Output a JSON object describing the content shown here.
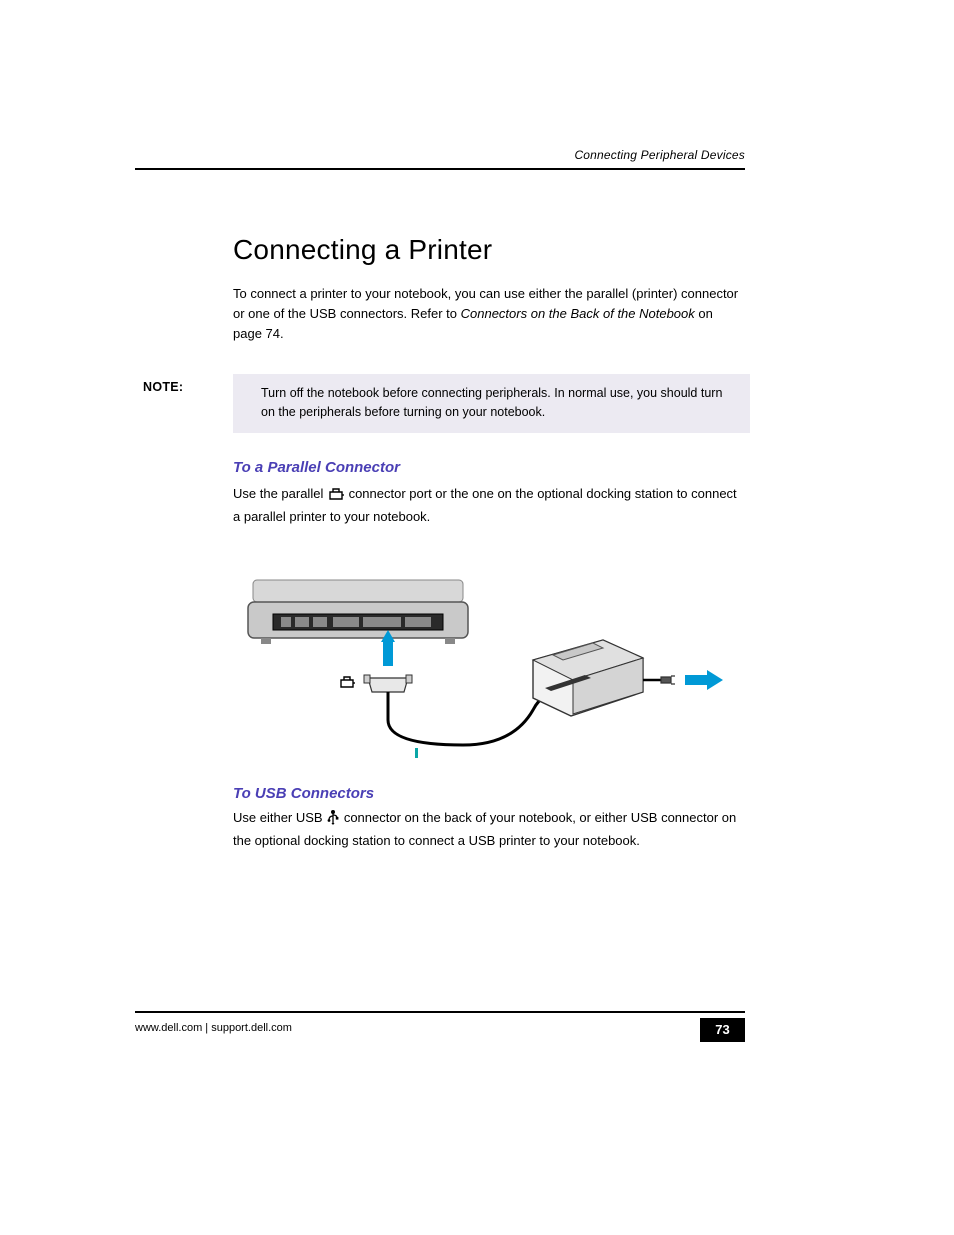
{
  "header": {
    "chapter_label": "Connecting Peripheral Devices"
  },
  "section": {
    "title": "Connecting a Printer",
    "intro_part1": "To connect a printer to your notebook, you can use either the parallel (printer) connector or one of the USB connectors. Refer to ",
    "intro_em": "Connectors on the Back of the Notebook",
    "intro_part2": " on page 74."
  },
  "note": {
    "label": "NOTE:",
    "text": "Turn off the notebook before connecting peripherals. In normal use, you should turn on the peripherals before turning on your notebook."
  },
  "parallel": {
    "heading": "To a Parallel Connector",
    "before_icon": "Use the parallel ",
    "after_icon": " connector port or the one on the optional docking station to connect a parallel printer to your notebook."
  },
  "usb": {
    "heading": "To USB Connectors",
    "before_icon": "Use either USB ",
    "after_icon": " connector on the back of your notebook, or either USB connector on the optional docking station to connect a USB printer to your notebook."
  },
  "footer": {
    "text": "www.dell.com | support.dell.com",
    "page_number": "73"
  }
}
